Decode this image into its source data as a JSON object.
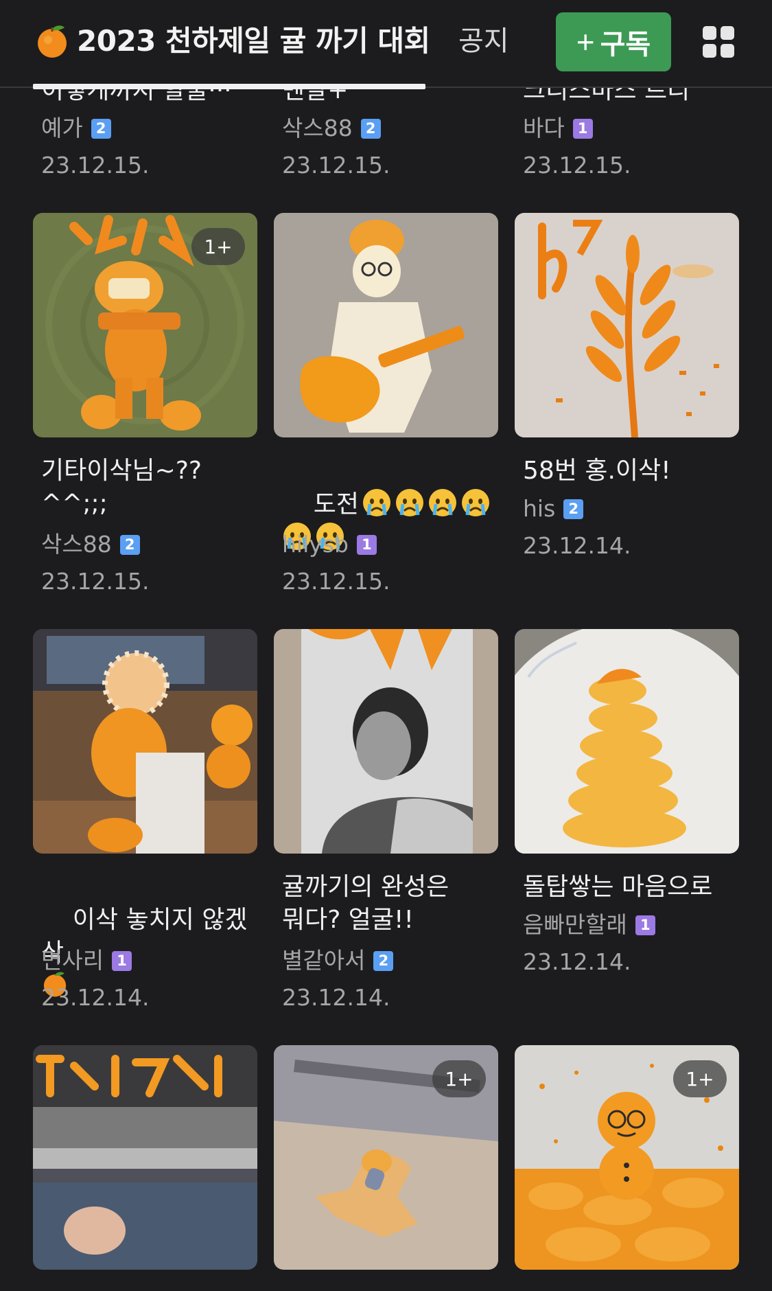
{
  "header": {
    "title": "2023 천하제일 귤 까기 대회",
    "notice_label": "공지",
    "subscribe_label": "구독",
    "subscribe_plus": "+",
    "accent_color": "#3d9a54"
  },
  "posts_top": [
    {
      "title": "이렇게까지 할줄···",
      "author": "예가",
      "level": "2",
      "date": "23.12.15."
    },
    {
      "title": "멘탈+",
      "author": "삭스88",
      "level": "2",
      "date": "23.12.15."
    },
    {
      "title": "크리스마스 트리",
      "author": "바다",
      "level": "1",
      "date": "23.12.15."
    }
  ],
  "posts_row1": [
    {
      "title": "기타이삭님~??\n^^;;;",
      "author": "삭스88",
      "level": "2",
      "date": "23.12.15.",
      "count": "1+"
    },
    {
      "title": "도전",
      "emoji_note": "crying-face x6",
      "author": "hilysb",
      "level": "1",
      "date": "23.12.15."
    },
    {
      "title": "58번 홍.이삭!",
      "author": "his",
      "level": "2",
      "date": "23.12.14."
    }
  ],
  "posts_row2": [
    {
      "title": "이삭 놓치지 않겠삭",
      "author": "면사리",
      "level": "1",
      "date": "23.12.14."
    },
    {
      "title": "귤까기의 완성은\n뭐다? 얼굴!!",
      "author": "별같아서",
      "level": "2",
      "date": "23.12.14."
    },
    {
      "title": "돌탑쌓는 마음으로",
      "author": "음빠만할래",
      "level": "1",
      "date": "23.12.14."
    }
  ],
  "posts_row3": [
    {
      "count": ""
    },
    {
      "count": "1+"
    },
    {
      "count": "1+"
    }
  ]
}
